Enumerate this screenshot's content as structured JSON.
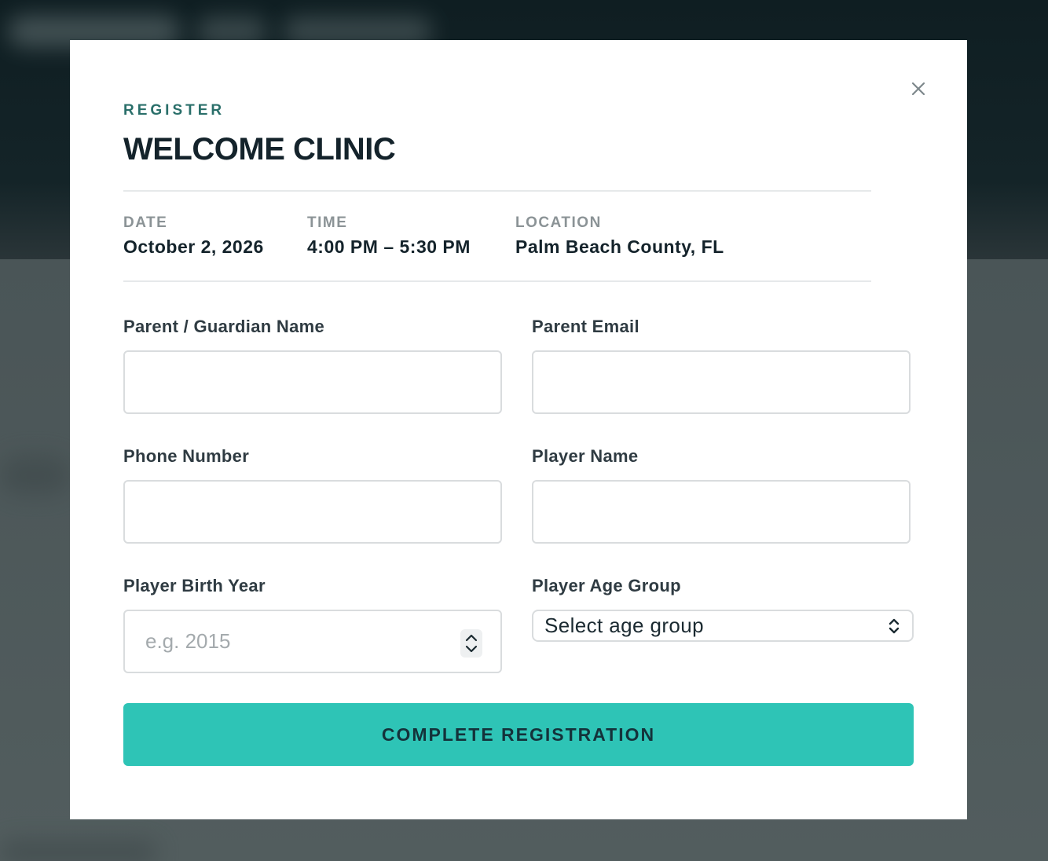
{
  "modal": {
    "eyebrow": "REGISTER",
    "title": "WELCOME CLINIC",
    "close_icon": "close-icon"
  },
  "event": {
    "date_label": "DATE",
    "date_value": "October 2, 2026",
    "time_label": "TIME",
    "time_value": "4:00 PM – 5:30 PM",
    "location_label": "LOCATION",
    "location_value": "Palm Beach County, FL"
  },
  "form": {
    "parent_name": {
      "label": "Parent / Guardian Name",
      "value": "",
      "placeholder": ""
    },
    "parent_email": {
      "label": "Parent Email",
      "value": "",
      "placeholder": ""
    },
    "phone": {
      "label": "Phone Number",
      "value": "",
      "placeholder": ""
    },
    "player_name": {
      "label": "Player Name",
      "value": "",
      "placeholder": ""
    },
    "birth_year": {
      "label": "Player Birth Year",
      "value": "",
      "placeholder": "e.g. 2015"
    },
    "age_group": {
      "label": "Player Age Group",
      "selected": "Select age group"
    },
    "submit_label": "COMPLETE REGISTRATION"
  },
  "colors": {
    "accent": "#2ec4b6",
    "eyebrow": "#2a6f6a",
    "title": "#14232b"
  }
}
